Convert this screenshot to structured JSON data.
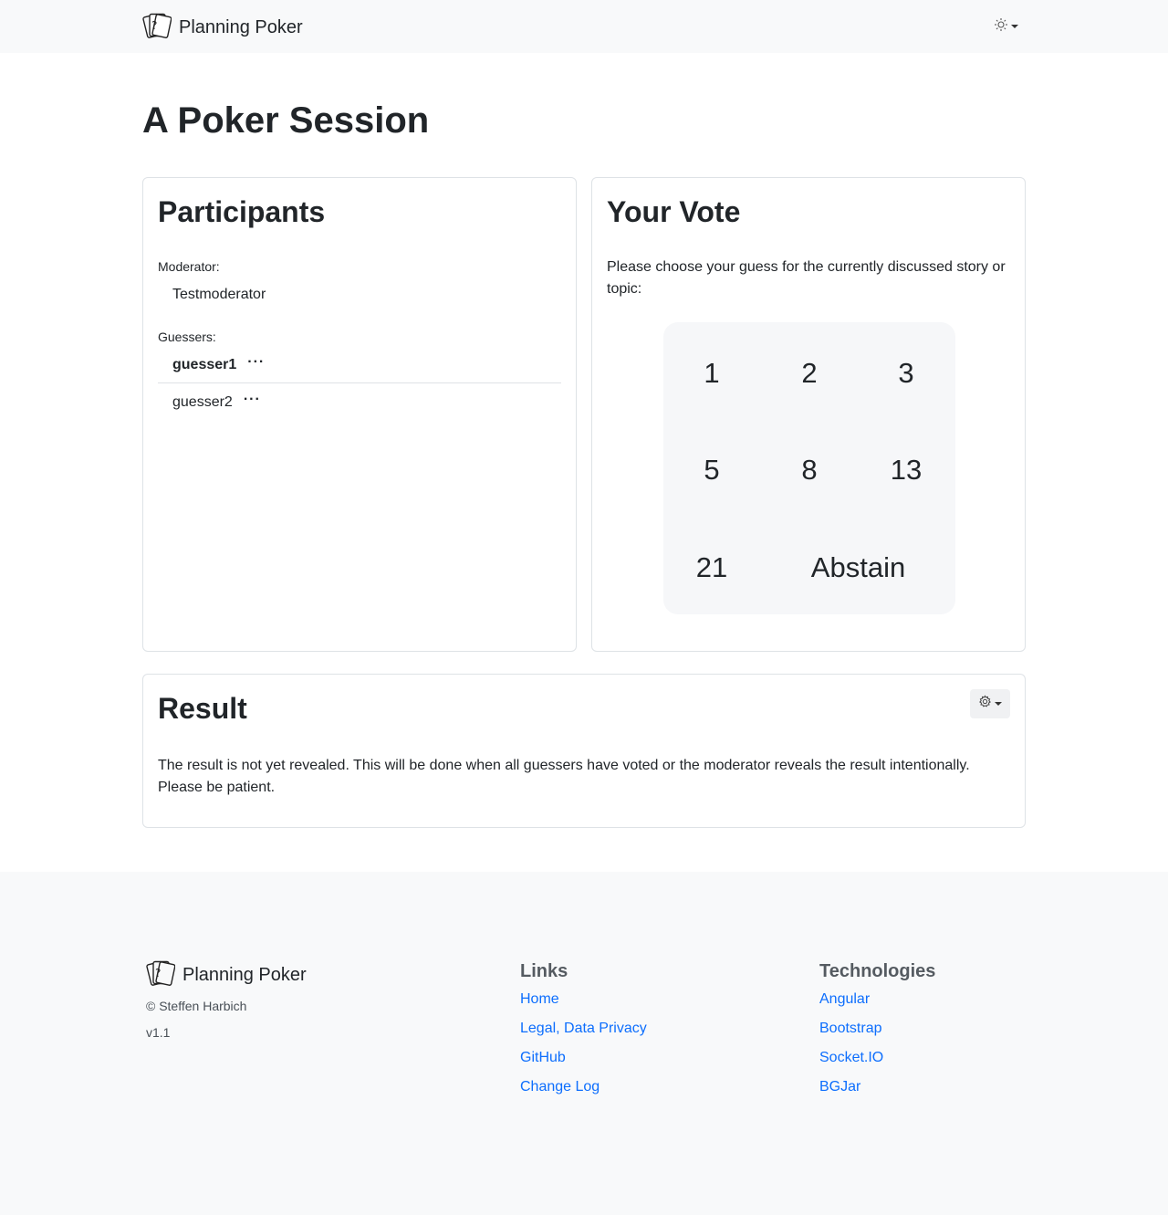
{
  "navbar": {
    "brand": "Planning Poker",
    "logo_icon": "playing-cards-icon",
    "theme_icon": "sun-icon"
  },
  "page": {
    "title": "A Poker Session"
  },
  "participants": {
    "title": "Participants",
    "moderator_label": "Moderator:",
    "moderator": "Testmoderator",
    "guessers_label": "Guessers:",
    "guessers": [
      {
        "name": "guesser1",
        "status": "···"
      },
      {
        "name": "guesser2",
        "status": "···"
      }
    ]
  },
  "vote": {
    "title": "Your Vote",
    "prompt": "Please choose your guess for the currently discussed story or topic:",
    "options": [
      "1",
      "2",
      "3",
      "5",
      "8",
      "13",
      "21",
      "Abstain"
    ]
  },
  "result": {
    "title": "Result",
    "text": "The result is not yet revealed. This will be done when all guessers have voted or the moderator reveals the result intentionally. Please be patient.",
    "settings_icon": "gear-icon"
  },
  "footer": {
    "brand": "Planning Poker",
    "copyright": "© Steffen Harbich",
    "version": "v1.1",
    "links_title": "Links",
    "links": [
      "Home",
      "Legal, Data Privacy",
      "GitHub",
      "Change Log"
    ],
    "tech_title": "Technologies",
    "technologies": [
      "Angular",
      "Bootstrap",
      "Socket.IO",
      "BGJar"
    ]
  }
}
